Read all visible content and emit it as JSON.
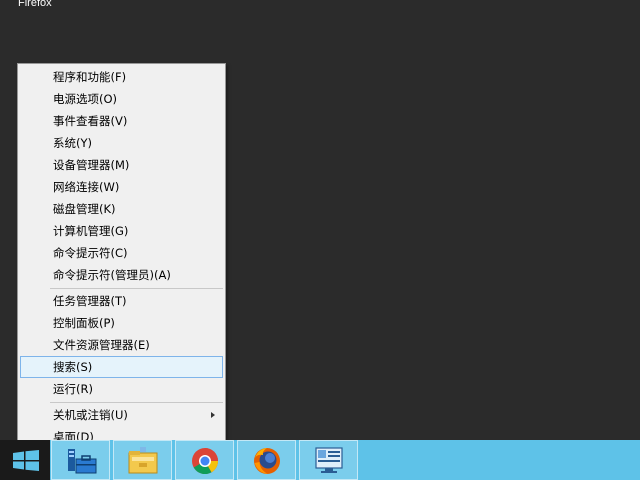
{
  "desktop": {
    "label": "Firefox"
  },
  "context_menu": {
    "group1": [
      {
        "label": "程序和功能(F)"
      },
      {
        "label": "电源选项(O)"
      },
      {
        "label": "事件查看器(V)"
      },
      {
        "label": "系统(Y)"
      },
      {
        "label": "设备管理器(M)"
      },
      {
        "label": "网络连接(W)"
      },
      {
        "label": "磁盘管理(K)"
      },
      {
        "label": "计算机管理(G)"
      },
      {
        "label": "命令提示符(C)"
      },
      {
        "label": "命令提示符(管理员)(A)"
      }
    ],
    "group2": [
      {
        "label": "任务管理器(T)"
      },
      {
        "label": "控制面板(P)"
      },
      {
        "label": "文件资源管理器(E)"
      },
      {
        "label": "搜索(S)",
        "selected": true
      },
      {
        "label": "运行(R)"
      }
    ],
    "group3": [
      {
        "label": "关机或注销(U)",
        "has_submenu": true
      },
      {
        "label": "桌面(D)"
      }
    ]
  },
  "taskbar": {
    "background_color": "#5ec2e8",
    "start_icon": "windows-logo-icon",
    "pinned": [
      {
        "icon": "server-manager-icon"
      },
      {
        "icon": "file-explorer-icon"
      },
      {
        "icon": "chrome-icon"
      },
      {
        "icon": "firefox-icon"
      },
      {
        "icon": "remote-desktop-icon"
      }
    ]
  },
  "colors": {
    "desktop": "#2b2b2b",
    "menu_bg": "#f0f0f0",
    "selected_bg": "#e5f3fb",
    "selected_border": "#7eb4ea"
  }
}
